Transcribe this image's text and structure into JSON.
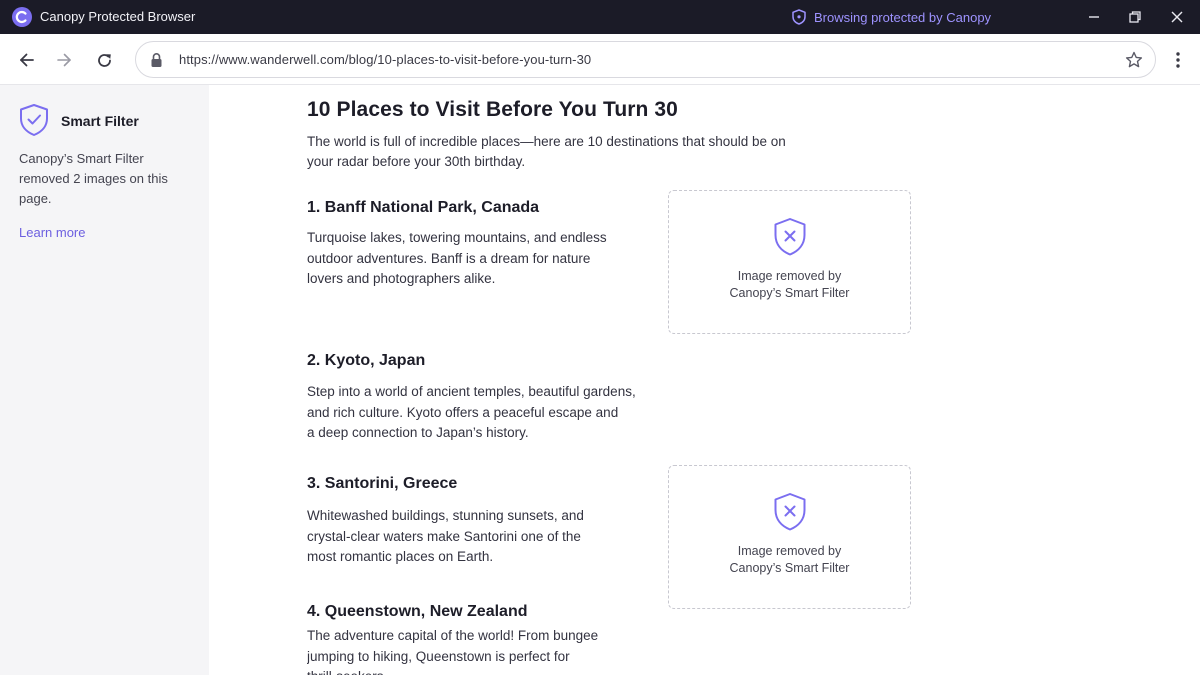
{
  "window": {
    "title": "Canopy Protected Browser",
    "protection_status": "Browsing protected by Canopy",
    "accent": "#7b6ef0"
  },
  "nav": {
    "url": "https://www.wanderwell.com/blog/10-places-to-visit-before-you-turn-30",
    "icons": [
      "back-arrow-icon",
      "forward-arrow-icon",
      "reload-icon",
      "lock-icon",
      "star-icon",
      "kebab-menu-icon"
    ]
  },
  "sidebar": {
    "title": "Smart Filter",
    "description": "Canopy’s Smart Filter removed 2 images on this page.",
    "link": "Learn more"
  },
  "article": {
    "title": "10 Places to Visit Before You Turn 30",
    "intro_lines": [
      "The world is full of incredible places—here are 10 destinations that should be on",
      "your radar before your 30th birthday."
    ],
    "sections": [
      {
        "heading": "1. Banff National Park, Canada",
        "lines": [
          "Turquoise lakes, towering mountains, and endless",
          "outdoor adventures. Banff is a dream for nature",
          "lovers and photographers alike."
        ]
      },
      {
        "heading": "2. Kyoto, Japan",
        "lines": [
          "Step into a world of ancient temples, beautiful gardens,",
          "and rich culture. Kyoto offers a peaceful escape and",
          "a deep connection to Japan’s history."
        ]
      },
      {
        "heading": "3. Santorini, Greece",
        "lines": [
          "Whitewashed buildings, stunning sunsets, and",
          "crystal-clear waters make Santorini one of the",
          "most romantic places on Earth."
        ]
      },
      {
        "heading": "4. Queenstown, New Zealand",
        "lines": [
          "The adventure capital of the world! From bungee",
          "jumping to hiking, Queenstown is perfect for",
          "thrill-seekers."
        ]
      }
    ],
    "removed_image_lines": [
      "Image removed by",
      "Canopy’s Smart Filter"
    ]
  }
}
